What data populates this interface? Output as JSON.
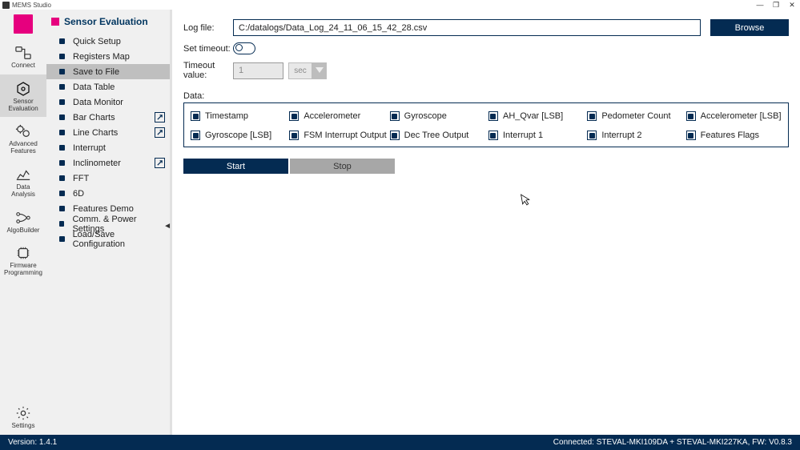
{
  "window": {
    "title": "MEMS Studio",
    "min": "—",
    "max": "▢",
    "close": "✕"
  },
  "rail": {
    "items": [
      {
        "label": "Connect"
      },
      {
        "label": "Sensor\nEvaluation"
      },
      {
        "label": "Advanced\nFeatures"
      },
      {
        "label": "Data\nAnalysis"
      },
      {
        "label": "AlgoBuilder"
      },
      {
        "label": "Firmware\nProgramming"
      }
    ],
    "settings_label": "Settings"
  },
  "sidebar": {
    "title": "Sensor Evaluation",
    "items": [
      {
        "label": "Quick Setup"
      },
      {
        "label": "Registers Map"
      },
      {
        "label": "Save to File"
      },
      {
        "label": "Data Table"
      },
      {
        "label": "Data Monitor"
      },
      {
        "label": "Bar Charts"
      },
      {
        "label": "Line Charts"
      },
      {
        "label": "Interrupt"
      },
      {
        "label": "Inclinometer"
      },
      {
        "label": "FFT"
      },
      {
        "label": "6D"
      },
      {
        "label": "Features Demo"
      },
      {
        "label": "Comm. & Power Settings"
      },
      {
        "label": "Load/Save Configuration"
      }
    ],
    "selected_index": 2,
    "external_indices": [
      5,
      6,
      8
    ]
  },
  "form": {
    "log_file_label": "Log file:",
    "log_file_value": "C:/datalogs/Data_Log_24_11_06_15_42_28.csv",
    "browse_label": "Browse",
    "set_timeout_label": "Set timeout:",
    "set_timeout_on": false,
    "timeout_value_label": "Timeout value:",
    "timeout_value": "1",
    "timeout_unit": "sec"
  },
  "data": {
    "label": "Data:",
    "items": [
      "Timestamp",
      "Accelerometer",
      "Gyroscope",
      "AH_Qvar [LSB]",
      "Pedometer Count",
      "Accelerometer [LSB]",
      "Gyroscope [LSB]",
      "FSM Interrupt Output",
      "Dec Tree Output",
      "Interrupt 1",
      "Interrupt 2",
      "Features Flags"
    ],
    "checked_indices": [
      0,
      1,
      2,
      3,
      4,
      5,
      6,
      7,
      8,
      9,
      10,
      11
    ]
  },
  "buttons": {
    "start": "Start",
    "stop": "Stop"
  },
  "footer": {
    "version": "Version: 1.4.1",
    "status": "Connected:   STEVAL-MKI109DA + STEVAL-MKI227KA, FW: V0.8.3"
  }
}
